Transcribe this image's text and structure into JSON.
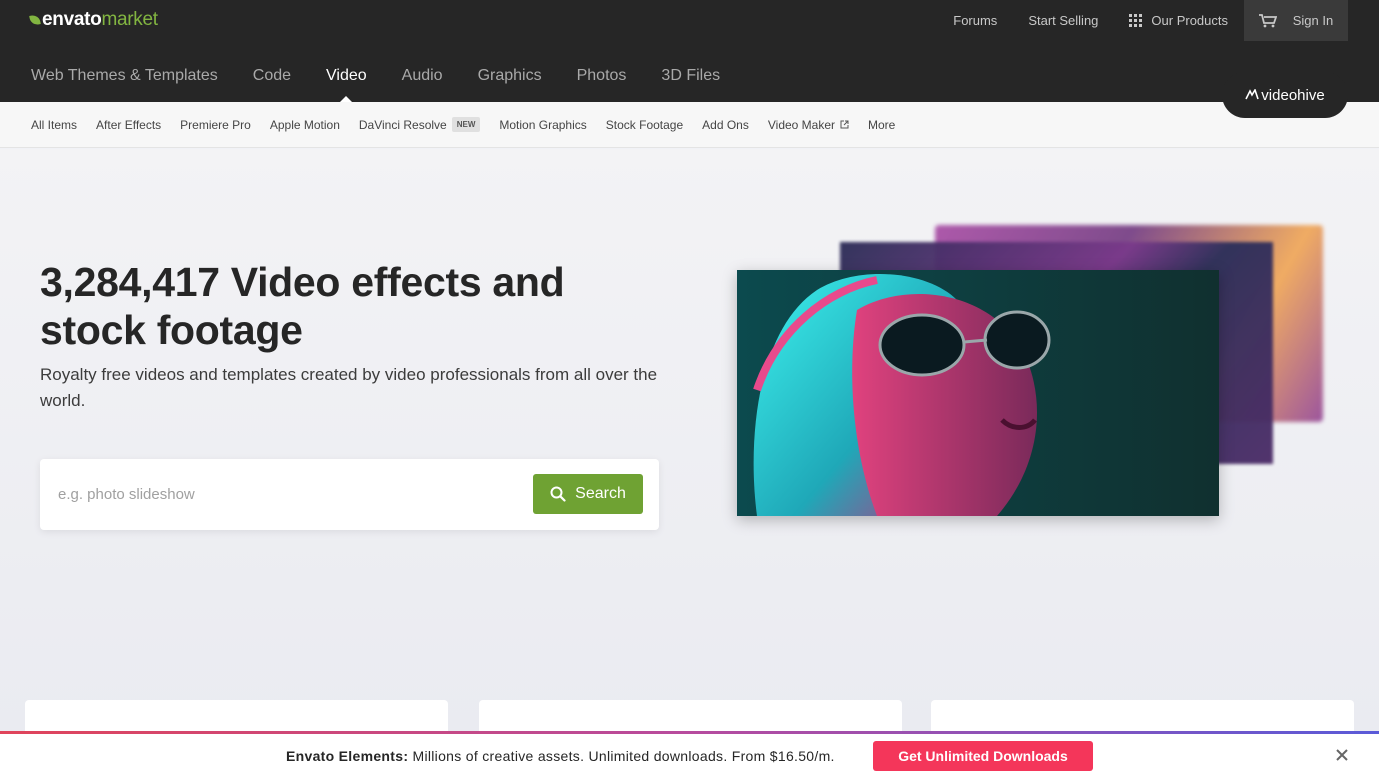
{
  "header": {
    "logo": {
      "primary": "envato",
      "secondary": "market"
    },
    "top_links": {
      "forums": "Forums",
      "start_selling": "Start Selling",
      "our_products": "Our Products",
      "sign_in": "Sign In"
    },
    "categories": [
      {
        "label": "Web Themes & Templates"
      },
      {
        "label": "Code"
      },
      {
        "label": "Video",
        "active": true
      },
      {
        "label": "Audio"
      },
      {
        "label": "Graphics"
      },
      {
        "label": "Photos"
      },
      {
        "label": "3D Files"
      }
    ],
    "marketplace_badge": "videohive"
  },
  "subnav": {
    "items": [
      {
        "label": "All Items"
      },
      {
        "label": "After Effects"
      },
      {
        "label": "Premiere Pro"
      },
      {
        "label": "Apple Motion"
      },
      {
        "label": "DaVinci Resolve",
        "tag": "NEW"
      },
      {
        "label": "Motion Graphics"
      },
      {
        "label": "Stock Footage"
      },
      {
        "label": "Add Ons"
      },
      {
        "label": "Video Maker",
        "external": true
      },
      {
        "label": "More"
      }
    ]
  },
  "hero": {
    "headline": "3,284,417 Video effects and stock footage",
    "subheadline": "Royalty free videos and templates created by video professionals from all over the world.",
    "search": {
      "placeholder": "e.g. photo slideshow",
      "value": "",
      "button_label": "Search"
    }
  },
  "promo": {
    "brand": "Envato Elements:",
    "message": "Millions of creative assets. Unlimited downloads. From $16.50/m.",
    "button_label": "Get Unlimited Downloads"
  },
  "colors": {
    "header_bg": "#262626",
    "brand_green": "#82b541",
    "search_button": "#6fa233",
    "promo_button": "#f4365a"
  },
  "icons": [
    "leaf-icon",
    "grid-icon",
    "cart-icon",
    "external-link-icon",
    "search-icon",
    "close-icon"
  ]
}
